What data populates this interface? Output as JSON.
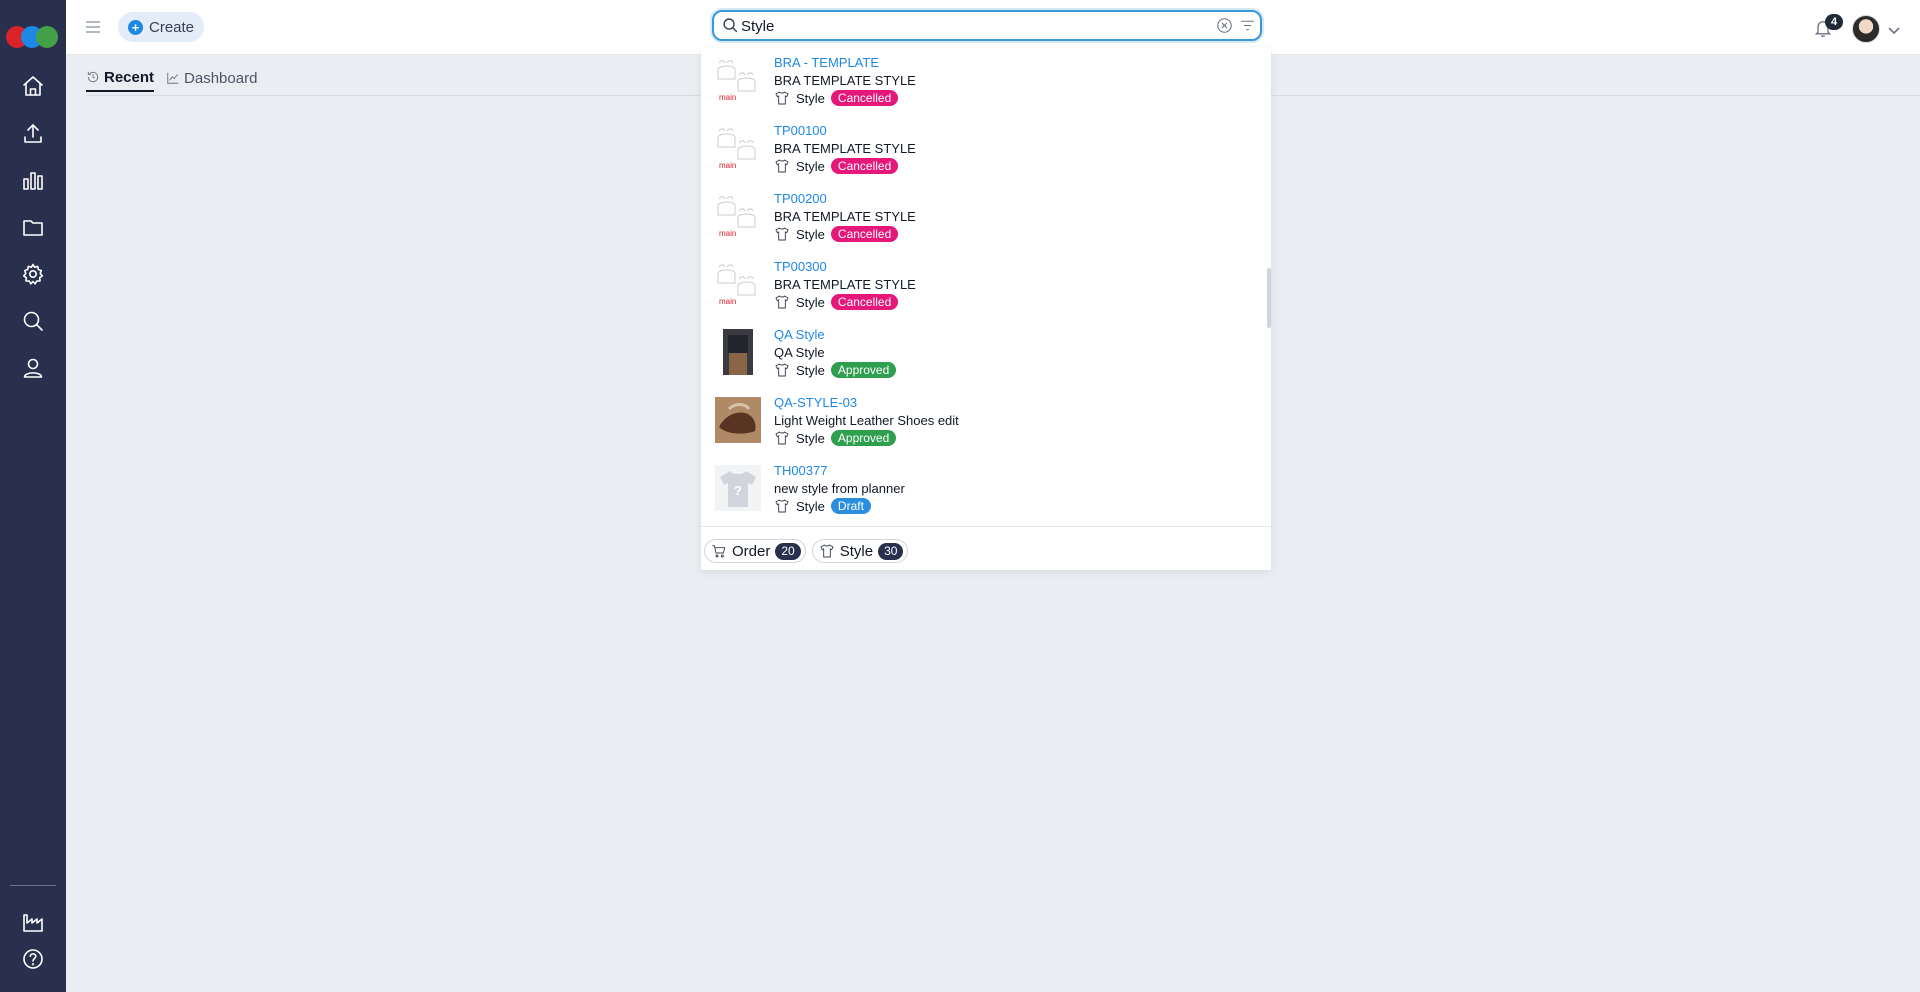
{
  "sidebar": {
    "items": [
      {
        "name": "home-icon"
      },
      {
        "name": "upload-icon"
      },
      {
        "name": "analytics-icon"
      },
      {
        "name": "folder-icon"
      },
      {
        "name": "settings-icon"
      },
      {
        "name": "search-icon"
      },
      {
        "name": "user-icon"
      },
      {
        "name": "factory-icon"
      },
      {
        "name": "help-icon"
      }
    ]
  },
  "header": {
    "create_label": "Create",
    "notification_count": "4"
  },
  "search": {
    "value": "Style"
  },
  "tabs": [
    {
      "label": "Recent",
      "icon": "history-icon",
      "active": true
    },
    {
      "label": "Dashboard",
      "icon": "chart-line-icon",
      "active": false
    }
  ],
  "results": [
    {
      "code": "BRA - TEMPLATE",
      "description": "BRA TEMPLATE STYLE",
      "type": "Style",
      "status": "Cancelled",
      "thumb_label": "main"
    },
    {
      "code": "TP00100",
      "description": "BRA TEMPLATE STYLE",
      "type": "Style",
      "status": "Cancelled",
      "thumb_label": "main"
    },
    {
      "code": "TP00200",
      "description": "BRA TEMPLATE STYLE",
      "type": "Style",
      "status": "Cancelled",
      "thumb_label": "main"
    },
    {
      "code": "TP00300",
      "description": "BRA TEMPLATE STYLE",
      "type": "Style",
      "status": "Cancelled",
      "thumb_label": "main"
    },
    {
      "code": "QA Style",
      "description": "QA Style",
      "type": "Style",
      "status": "Approved"
    },
    {
      "code": "QA-STYLE-03",
      "description": "Light Weight Leather Shoes edit",
      "type": "Style",
      "status": "Approved"
    },
    {
      "code": "TH00377",
      "description": "new style from planner",
      "type": "Style",
      "status": "Draft"
    }
  ],
  "categories": [
    {
      "label": "Order",
      "count": "20",
      "icon": "cart-icon"
    },
    {
      "label": "Style",
      "count": "30",
      "icon": "tshirt-icon"
    }
  ],
  "colors": {
    "sidebar": "#28304e",
    "accent": "#1e88e5",
    "cancelled": "#e5177a",
    "approved": "#2e9e4f",
    "draft": "#2a8ddd"
  }
}
